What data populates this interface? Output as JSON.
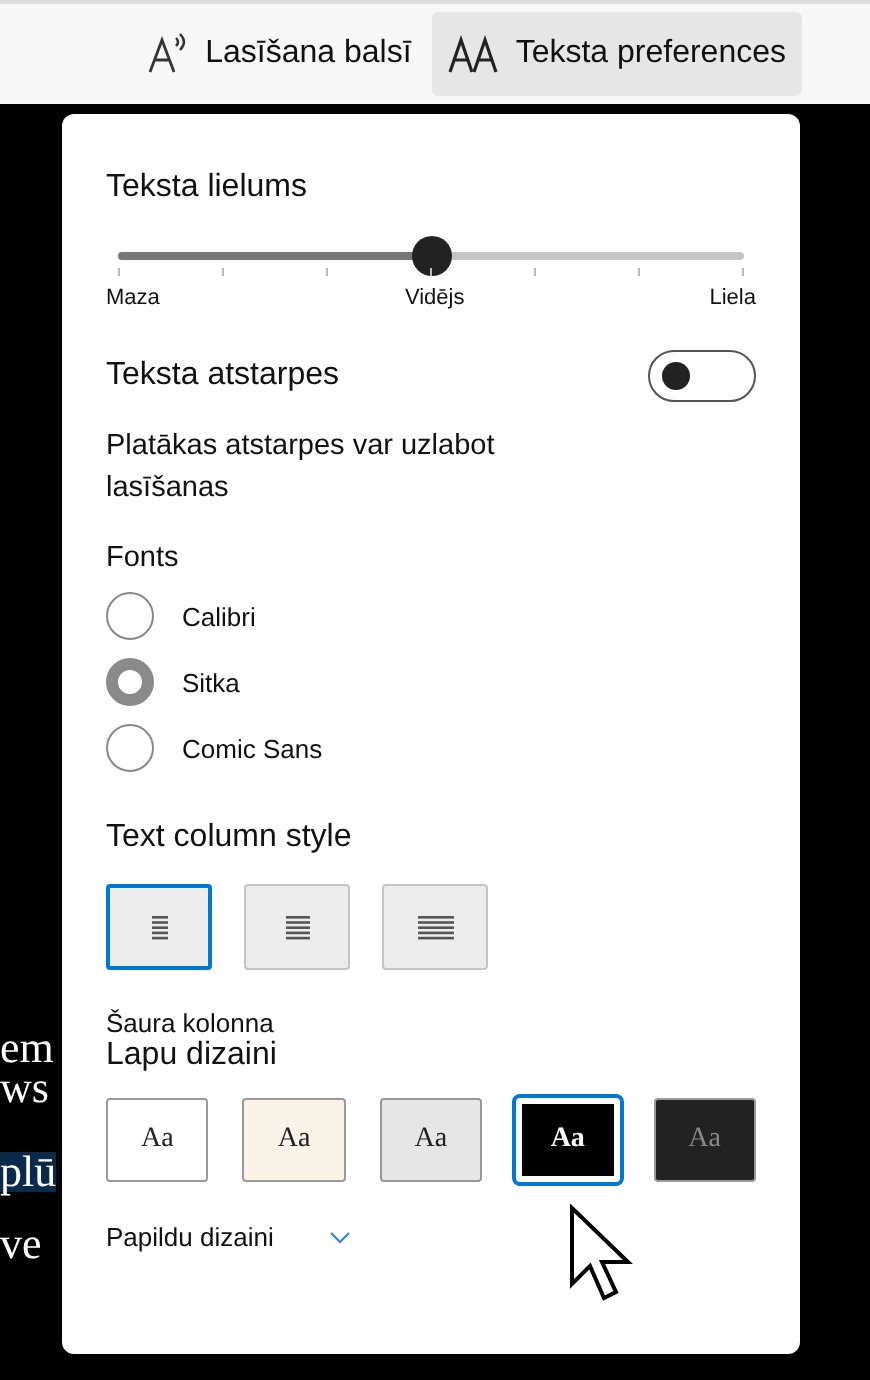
{
  "toolbar": {
    "buttons": [
      {
        "kind": "read",
        "label": "Lasīšana balsī",
        "selected": false
      },
      {
        "kind": "text",
        "label": "Teksta preferences",
        "selected": true
      }
    ]
  },
  "page_text": [
    {
      "text": "em",
      "highlighted": false
    },
    {
      "text": "ws",
      "highlighted": false
    },
    {
      "text": "plū",
      "highlighted": true
    },
    {
      "text": "ve",
      "highlighted": false
    }
  ],
  "panel": {
    "text_size": {
      "title": "Teksta lielums",
      "level": 0.5,
      "labels": [
        "Maza",
        "Vidējs",
        "Liela"
      ]
    },
    "spacing": {
      "title": "Teksta atstarpes",
      "on": false,
      "description": "Platākas atstarpes var uzlabot lasīšanas"
    },
    "fonts": {
      "title": "Fonts",
      "options": [
        {
          "label": "Calibri",
          "selected": false
        },
        {
          "label": "Sitka",
          "selected": true
        },
        {
          "label": "Comic Sans",
          "selected": false
        }
      ]
    },
    "column_style": {
      "title": "Text column style",
      "options": [
        {
          "kind": "narrow",
          "selected": true
        },
        {
          "kind": "medium",
          "selected": false
        },
        {
          "kind": "wide",
          "selected": false
        }
      ],
      "caption": "Šaura kolonna"
    },
    "themes": {
      "title": "Lapu dizaini",
      "options": [
        {
          "label": "Aa",
          "color": "#ffffff",
          "selected": false
        },
        {
          "label": "Aa",
          "color": "#f8f3e6",
          "selected": false
        },
        {
          "label": "Aa",
          "color": "#e6e6e6",
          "selected": false
        },
        {
          "label": "Aa",
          "color": "#000000",
          "selected": true
        },
        {
          "label": "Aa",
          "color": "#222222",
          "selected": false
        }
      ],
      "more": "Papildu dizaini"
    }
  }
}
